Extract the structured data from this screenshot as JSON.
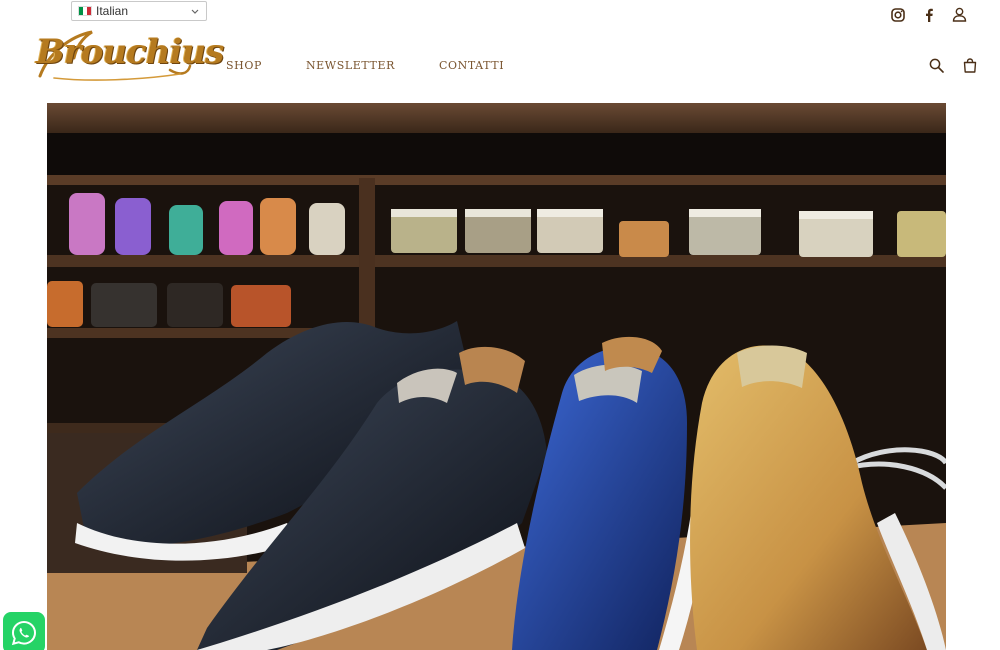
{
  "language": {
    "selected": "Italian"
  },
  "brand": {
    "logo_text": "Brouchius"
  },
  "nav": {
    "items": [
      {
        "label": "SHOP"
      },
      {
        "label": "NEWSLETTER"
      },
      {
        "label": "CONTATTI"
      }
    ]
  },
  "icons": {
    "social": [
      "instagram-icon",
      "facebook-icon",
      "account-icon"
    ],
    "utility": [
      "search-icon",
      "cart-icon"
    ],
    "floating": "whatsapp-icon"
  },
  "colors": {
    "brand_gold": "#b57a1f",
    "nav_text": "#7a5530",
    "whatsapp": "#25d366"
  }
}
